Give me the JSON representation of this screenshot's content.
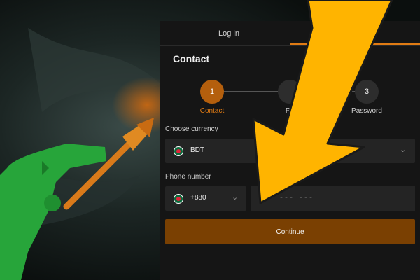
{
  "tabs": {
    "login": "Log in"
  },
  "title": "Contact",
  "steps": [
    {
      "number": "1",
      "label": "Contact"
    },
    {
      "number": "",
      "label": "Pe"
    },
    {
      "number": "3",
      "label": "Password"
    }
  ],
  "currency": {
    "label": "Choose currency",
    "value": "BDT"
  },
  "phone": {
    "label": "Phone number",
    "code": "+880",
    "placeholder": "--- --- ---"
  },
  "continue_label": "Continue",
  "colors": {
    "accent": "#e07b14",
    "button": "#7a4002",
    "arrow": "#ffb400"
  }
}
